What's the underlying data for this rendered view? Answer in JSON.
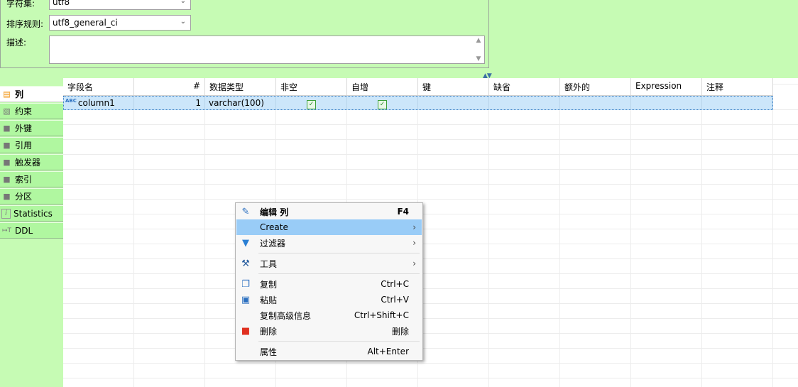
{
  "properties": {
    "charset_label": "字符集:",
    "charset_value": "utf8",
    "collation_label": "排序规则:",
    "collation_value": "utf8_general_ci",
    "description_label": "描述:",
    "description_value": ""
  },
  "tabs": [
    {
      "label": "列",
      "icon": "columns-icon"
    },
    {
      "label": "约束",
      "icon": "folder-icon"
    },
    {
      "label": "外键",
      "icon": "folder-icon"
    },
    {
      "label": "引用",
      "icon": "folder-icon"
    },
    {
      "label": "触发器",
      "icon": "folder-icon"
    },
    {
      "label": "索引",
      "icon": "folder-icon"
    },
    {
      "label": "分区",
      "icon": "folder-icon"
    },
    {
      "label": "Statistics",
      "icon": "info-icon"
    },
    {
      "label": "DDL",
      "icon": "ddl-icon"
    }
  ],
  "grid": {
    "headers": [
      "字段名",
      "#",
      "数据类型",
      "非空",
      "自增",
      "键",
      "缺省",
      "额外的",
      "Expression",
      "注释"
    ],
    "rows": [
      {
        "name": "column1",
        "type_badge": "ABC",
        "num": "1",
        "type": "varchar(100)",
        "not_null": true,
        "auto_inc": true,
        "key": "",
        "default": "",
        "extra": "",
        "expression": "",
        "comment": ""
      }
    ]
  },
  "context_menu": {
    "items": [
      {
        "label": "编辑 列",
        "shortcut": "F4",
        "icon": "pencil-icon"
      },
      {
        "label": "Create",
        "shortcut": "",
        "icon": ""
      },
      {
        "label": "过滤器",
        "shortcut": "",
        "icon": "filter-icon"
      },
      {
        "label": "工具",
        "shortcut": "",
        "icon": "tools-icon"
      },
      {
        "label": "复制",
        "shortcut": "Ctrl+C",
        "icon": "copy-icon"
      },
      {
        "label": "粘贴",
        "shortcut": "Ctrl+V",
        "icon": "paste-icon"
      },
      {
        "label": "复制高级信息",
        "shortcut": "Ctrl+Shift+C",
        "icon": ""
      },
      {
        "label": "删除",
        "shortcut": "删除",
        "icon": "trash-icon"
      },
      {
        "label": "属性",
        "shortcut": "Alt+Enter",
        "icon": ""
      }
    ]
  },
  "colors": {
    "background": "#c6fbb4",
    "selection": "#cce6fa",
    "menu_highlight": "#99ccf7",
    "accent_orange": "#f08c00"
  }
}
